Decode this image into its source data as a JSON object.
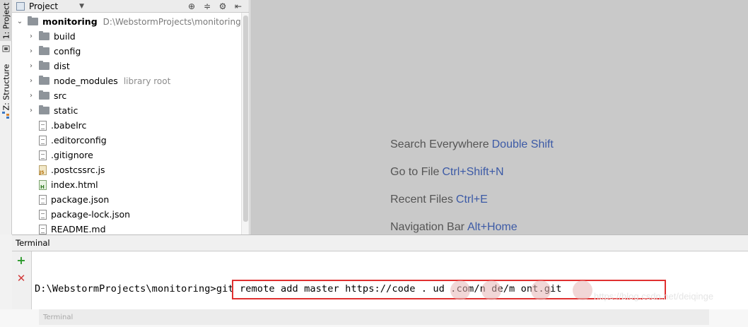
{
  "left_strip": {
    "project_tab": "1: Project",
    "structure_tab": "Z: Structure"
  },
  "project_panel": {
    "title": "Project",
    "root": {
      "name": "monitoring",
      "path": "D:\\WebstormProjects\\monitoring"
    },
    "items": [
      {
        "name": "build",
        "type": "folder",
        "hint": ""
      },
      {
        "name": "config",
        "type": "folder",
        "hint": ""
      },
      {
        "name": "dist",
        "type": "folder",
        "hint": ""
      },
      {
        "name": "node_modules",
        "type": "folder",
        "hint": "library root"
      },
      {
        "name": "src",
        "type": "folder",
        "hint": ""
      },
      {
        "name": "static",
        "type": "folder",
        "hint": ""
      },
      {
        "name": ".babelrc",
        "type": "config-file",
        "hint": ""
      },
      {
        "name": ".editorconfig",
        "type": "text-file",
        "hint": ""
      },
      {
        "name": ".gitignore",
        "type": "text-file",
        "hint": ""
      },
      {
        "name": ".postcssrc.js",
        "type": "js-file",
        "hint": ""
      },
      {
        "name": "index.html",
        "type": "html-file",
        "hint": ""
      },
      {
        "name": "package.json",
        "type": "config-file",
        "hint": ""
      },
      {
        "name": "package-lock.json",
        "type": "config-file",
        "hint": ""
      },
      {
        "name": "README.md",
        "type": "text-file",
        "hint": ""
      }
    ]
  },
  "editor_hints": [
    {
      "label": "Search Everywhere",
      "key": "Double Shift"
    },
    {
      "label": "Go to File",
      "key": "Ctrl+Shift+N"
    },
    {
      "label": "Recent Files",
      "key": "Ctrl+E"
    },
    {
      "label": "Navigation Bar",
      "key": "Alt+Home"
    }
  ],
  "terminal": {
    "title": "Terminal",
    "prompt": "D:\\WebstormProjects\\monitoring>",
    "command": "git remote add master https://code    .   ud    .com/n    de/m     ont.git",
    "bottom_tab": "Terminal"
  },
  "watermark": "https://blog.csdn.net/deiqinge",
  "colors": {
    "accent_key": "#3c5aa6",
    "highlight_border": "#e03030",
    "add_green": "#2c9a2c",
    "close_red": "#d23b3b"
  }
}
